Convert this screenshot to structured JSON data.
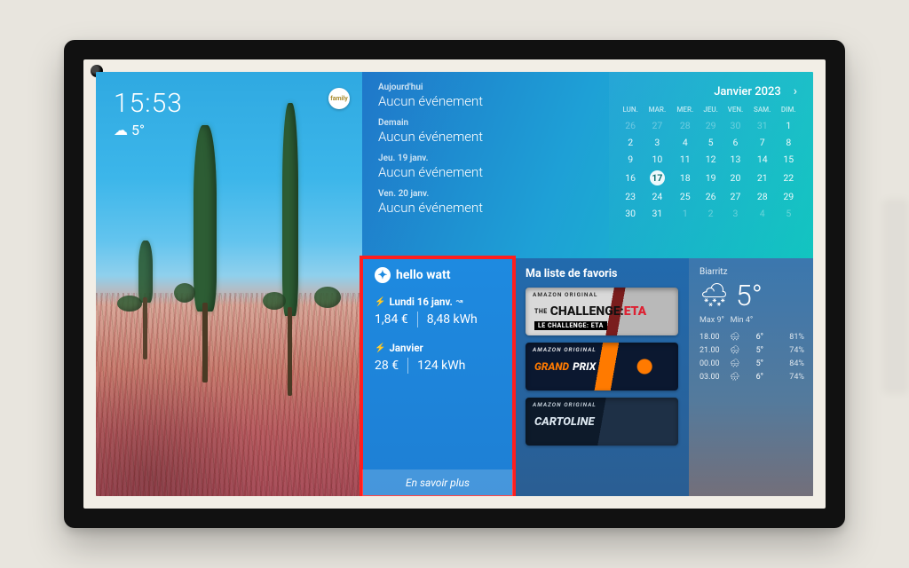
{
  "clock": "15:53",
  "outside_temp": "5°",
  "badge_text": "family",
  "agenda": [
    {
      "label": "Aujourd'hui",
      "text": "Aucun événement"
    },
    {
      "label": "Demain",
      "text": "Aucun événement"
    },
    {
      "label": "Jeu. 19 janv.",
      "text": "Aucun événement"
    },
    {
      "label": "Ven. 20 janv.",
      "text": "Aucun événement"
    }
  ],
  "calendar": {
    "title": "Janvier 2023",
    "weekdays": [
      "LUN.",
      "MAR.",
      "MER.",
      "JEU.",
      "VEN.",
      "SAM.",
      "DIM."
    ],
    "weeks": [
      [
        {
          "d": "26",
          "dim": true
        },
        {
          "d": "27",
          "dim": true
        },
        {
          "d": "28",
          "dim": true
        },
        {
          "d": "29",
          "dim": true
        },
        {
          "d": "30",
          "dim": true
        },
        {
          "d": "31",
          "dim": true
        },
        {
          "d": "1"
        }
      ],
      [
        {
          "d": "2"
        },
        {
          "d": "3"
        },
        {
          "d": "4"
        },
        {
          "d": "5"
        },
        {
          "d": "6"
        },
        {
          "d": "7"
        },
        {
          "d": "8"
        }
      ],
      [
        {
          "d": "9"
        },
        {
          "d": "10"
        },
        {
          "d": "11"
        },
        {
          "d": "12"
        },
        {
          "d": "13"
        },
        {
          "d": "14"
        },
        {
          "d": "15"
        }
      ],
      [
        {
          "d": "16"
        },
        {
          "d": "17",
          "today": true
        },
        {
          "d": "18"
        },
        {
          "d": "19"
        },
        {
          "d": "20"
        },
        {
          "d": "21"
        },
        {
          "d": "22"
        }
      ],
      [
        {
          "d": "23"
        },
        {
          "d": "24"
        },
        {
          "d": "25"
        },
        {
          "d": "26"
        },
        {
          "d": "27"
        },
        {
          "d": "28"
        },
        {
          "d": "29"
        }
      ],
      [
        {
          "d": "30"
        },
        {
          "d": "31"
        },
        {
          "d": "1",
          "dim": true
        },
        {
          "d": "2",
          "dim": true
        },
        {
          "d": "3",
          "dim": true
        },
        {
          "d": "4",
          "dim": true
        },
        {
          "d": "5",
          "dim": true
        }
      ]
    ]
  },
  "hello_watt": {
    "title": "hello watt",
    "day_label": "Lundi 16 janv.",
    "day_cost": "1,84 €",
    "day_kwh": "8,48 kWh",
    "month_label": "Janvier",
    "month_cost": "28 €",
    "month_kwh": "124 kWh",
    "more": "En savoir plus"
  },
  "favorites": {
    "title": "Ma liste de favoris",
    "tag": "AMAZON ORIGINAL",
    "card1_main": "CHALLENGE:",
    "card1_accent": "ETA",
    "card1_prefix": "THE",
    "card1_sub": "LE CHALLENGE: ETA",
    "card2_a": "GRAND",
    "card2_b": "PRIX",
    "card3": "CARTOLINE"
  },
  "weather": {
    "location": "Biarritz",
    "now_temp": "5°",
    "max_label": "Max 9°",
    "min_label": "Min 4°",
    "hours": [
      {
        "h": "18.00",
        "icon": "snow",
        "t": "6°",
        "p": "81%"
      },
      {
        "h": "21.00",
        "icon": "snow",
        "t": "5°",
        "p": "74%"
      },
      {
        "h": "00.00",
        "icon": "snow",
        "t": "5°",
        "p": "84%"
      },
      {
        "h": "03.00",
        "icon": "rain",
        "t": "6°",
        "p": "74%"
      }
    ]
  }
}
